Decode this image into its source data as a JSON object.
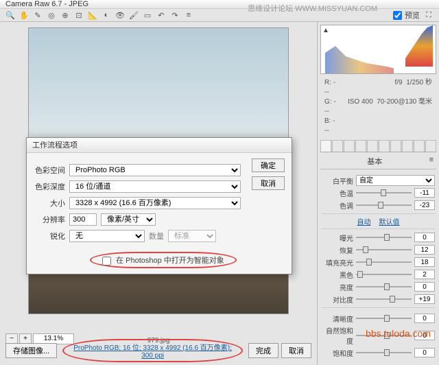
{
  "titlebar": {
    "title": "Camera Raw 6.7 - JPEG"
  },
  "watermark_top": "思缘设计论坛  WWW.MISSYUAN.COM",
  "toolbar": {
    "preview_label": "预览",
    "preview_checked": true
  },
  "info": {
    "r": "R: ---",
    "g": "G: ---",
    "b": "B: ---",
    "aperture": "f/9",
    "shutter": "1/250 秒",
    "iso": "ISO 400",
    "lens": "70-200@130 毫米"
  },
  "panel": {
    "title": "基本",
    "wb_label": "白平衡",
    "wb_value": "自定",
    "temp_label": "色温",
    "temp_value": "-11",
    "tint_label": "色调",
    "tint_value": "-23",
    "auto": "自动",
    "default": "默认值",
    "exposure_label": "曝光",
    "exposure_value": "0",
    "recovery_label": "恢复",
    "recovery_value": "12",
    "fill_label": "填充亮光",
    "fill_value": "18",
    "black_label": "黑色",
    "black_value": "2",
    "bright_label": "亮度",
    "bright_value": "0",
    "contrast_label": "对比度",
    "contrast_value": "+19",
    "clarity_label": "清晰度",
    "clarity_value": "0",
    "vibrance_label": "自然饱和度",
    "vibrance_value": "0",
    "saturation_label": "饱和度",
    "saturation_value": "0"
  },
  "dialog": {
    "title": "工作流程选项",
    "space_label": "色彩空间",
    "space_value": "ProPhoto RGB",
    "depth_label": "色彩深度",
    "depth_value": "16 位/通道",
    "size_label": "大小",
    "size_value": "3328 x 4992 (16.6 百万像素)",
    "res_label": "分辨率",
    "res_value": "300",
    "res_unit": "像素/英寸",
    "sharpen_label": "锐化",
    "sharpen_value": "无",
    "amount_label": "数量",
    "amount_value": "标准",
    "smartobj_label": "在 Photoshop 中打开为智能对象",
    "ok": "确定",
    "cancel": "取消"
  },
  "zoom": {
    "value": "13.1%"
  },
  "filename": "979.jpg",
  "filelink": "ProPhoto RGB; 16 位; 3328 x 4992 (16.6 百万像素); 300 ppi",
  "footer": {
    "save": "存储图像...",
    "done": "完成",
    "cancel": "取消"
  },
  "url_wm": "bbs.tuloda.com"
}
